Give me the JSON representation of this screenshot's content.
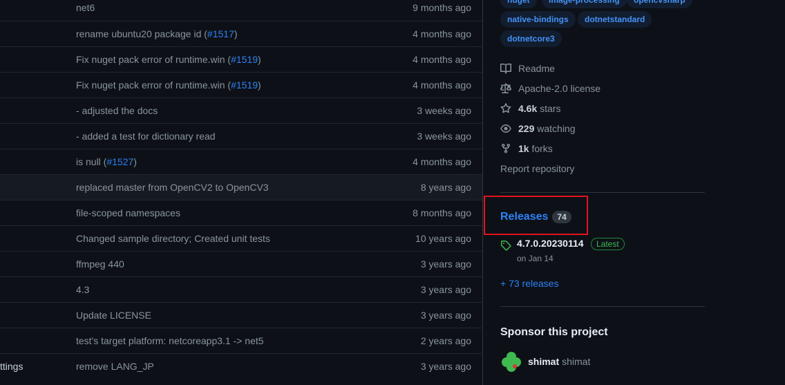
{
  "files": [
    {
      "name": "",
      "message": "net6",
      "pr": "",
      "age": "9 months ago"
    },
    {
      "name": "",
      "message": "rename ubuntu20 package id (",
      "pr": "#1517",
      "age": "4 months ago"
    },
    {
      "name": "",
      "message": "Fix nuget pack error of runtime.win (",
      "pr": "#1519",
      "age": "4 months ago"
    },
    {
      "name": "",
      "message": "Fix nuget pack error of runtime.win (",
      "pr": "#1519",
      "age": "4 months ago"
    },
    {
      "name": "",
      "message": "- adjusted the docs",
      "pr": "",
      "age": "3 weeks ago"
    },
    {
      "name": "",
      "message": "- added a test for dictionary read",
      "pr": "",
      "age": "3 weeks ago"
    },
    {
      "name": "",
      "message": "is null (",
      "pr": "#1527",
      "age": "4 months ago"
    },
    {
      "name": "",
      "message": "replaced master from OpenCV2 to OpenCV3",
      "pr": "",
      "age": "8 years ago"
    },
    {
      "name": "",
      "message": "file-scoped namespaces",
      "pr": "",
      "age": "8 months ago"
    },
    {
      "name": "",
      "message": "Changed sample directory; Created unit tests",
      "pr": "",
      "age": "10 years ago"
    },
    {
      "name": "",
      "message": "ffmpeg 440",
      "pr": "",
      "age": "3 years ago"
    },
    {
      "name": "",
      "message": "4.3",
      "pr": "",
      "age": "3 years ago"
    },
    {
      "name": "",
      "message": "Update LICENSE",
      "pr": "",
      "age": "3 years ago"
    },
    {
      "name": "",
      "message": "test's target platform: netcoreapp3.1 -> net5",
      "pr": "",
      "age": "2 years ago"
    },
    {
      "name": "ttings",
      "message": "remove LANG_JP",
      "pr": "",
      "age": "3 years ago"
    }
  ],
  "topics": [
    "nuget",
    "image-processing",
    "opencvsharp",
    "native-bindings",
    "dotnetstandard",
    "dotnetcore3"
  ],
  "about": {
    "readme": "Readme",
    "license": "Apache-2.0 license",
    "stars_count": "4.6k",
    "stars_label": "stars",
    "watching_count": "229",
    "watching_label": "watching",
    "forks_count": "1k",
    "forks_label": "forks",
    "report": "Report repository"
  },
  "releases": {
    "title": "Releases",
    "count": "74",
    "latest_name": "4.7.0.20230114",
    "latest_badge": "Latest",
    "latest_date": "on Jan 14",
    "more": "+ 73 releases"
  },
  "sponsor": {
    "title": "Sponsor this project",
    "login": "shimat",
    "username": "shimat"
  },
  "colors": {
    "accent": "#2f81f7",
    "highlight": "#e5121f",
    "success": "#3fb950"
  }
}
